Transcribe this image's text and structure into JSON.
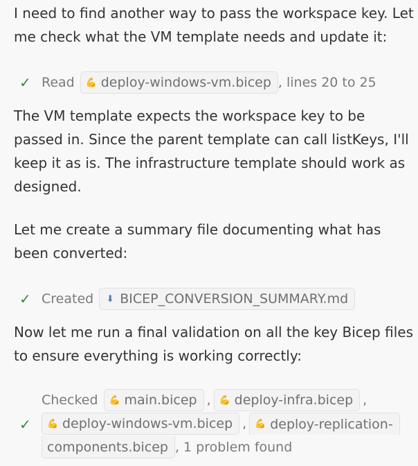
{
  "messages": {
    "p1": "I need to find another way to pass the workspace key. Let me check what the VM template needs and update it:",
    "read_tool": {
      "verb": "Read",
      "file": "deploy-windows-vm.bicep",
      "suffix": ", lines 20 to 25"
    },
    "p2": "The VM template expects the workspace key to be passed in. Since the parent template can call listKeys, I'll keep it as is. The infrastructure template should work as designed.",
    "p3": "Let me create a summary file documenting what has been converted:",
    "create_tool": {
      "verb": "Created",
      "file": "BICEP_CONVERSION_SUMMARY.md"
    },
    "p4": "Now let me run a final validation on all the key Bicep files to ensure everything is working correctly:",
    "check_tool": {
      "verb": "Checked",
      "files": [
        "main.bicep",
        "deploy-infra.bicep",
        "deploy-windows-vm.bicep",
        "deploy-replication-",
        "components.bicep"
      ],
      "comma": ",",
      "suffix": ", 1 problem found"
    }
  },
  "icons": {
    "check": "checkmark-icon",
    "bicep": "bicep-file-icon",
    "markdown": "markdown-file-icon"
  },
  "colors": {
    "background": "#f8f8f8",
    "text": "#333333",
    "muted": "#7a7a7a",
    "success": "#2e8a3a",
    "chip_border": "#e0e0e0"
  }
}
